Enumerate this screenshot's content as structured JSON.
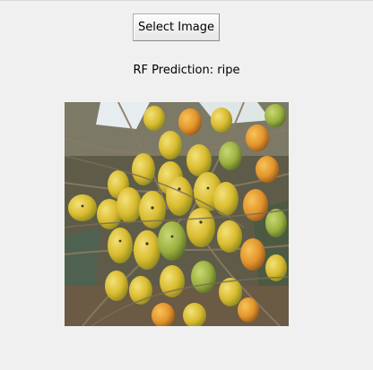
{
  "window": {
    "background": "#f0f0f0"
  },
  "controls": {
    "select_label": "Select Image"
  },
  "result": {
    "prediction_text": "RF Prediction: ripe"
  },
  "image": {
    "icon": "fruit-bunch-photo",
    "colors": {
      "ripe_yellow": "#e3c43a",
      "green_fruit": "#9fb84a",
      "orange_fruit": "#e49a2e",
      "stalk_brown": "#6a5a45",
      "sky_white": "#e8eef0"
    }
  }
}
